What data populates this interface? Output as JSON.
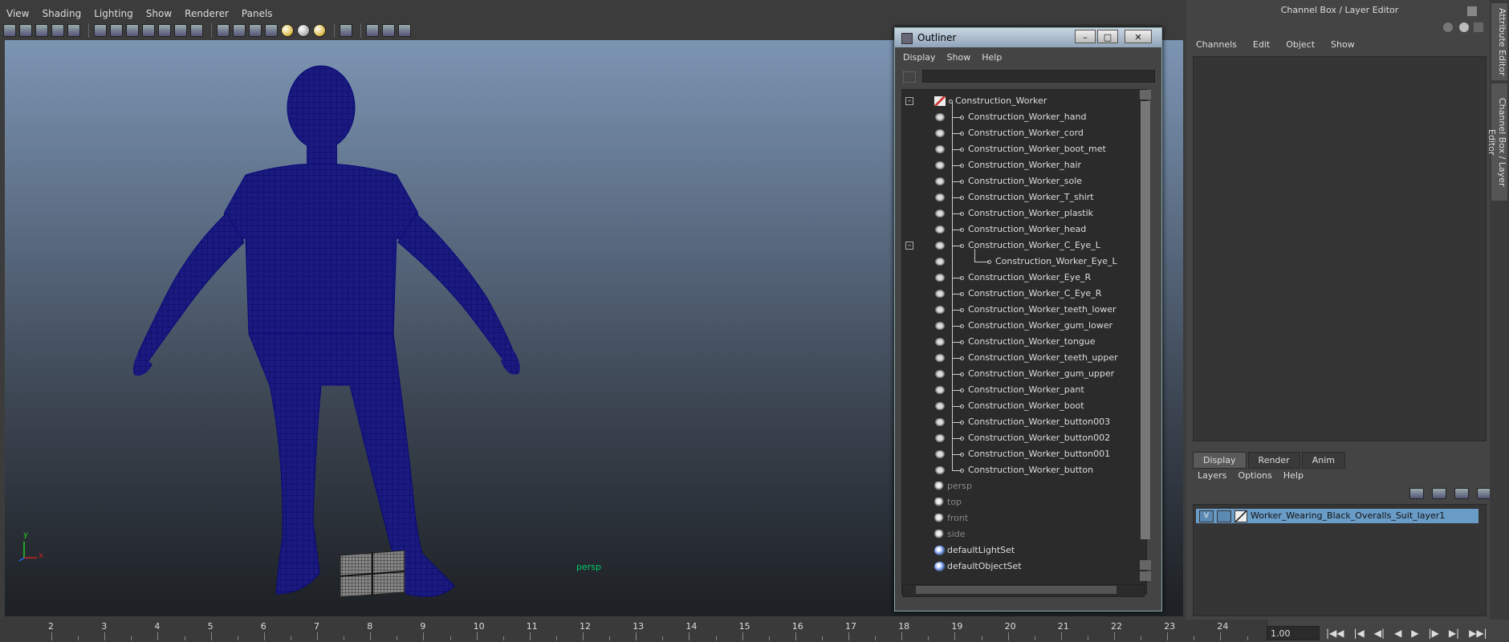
{
  "viewport": {
    "menu": [
      "View",
      "Shading",
      "Lighting",
      "Show",
      "Renderer",
      "Panels"
    ],
    "camera_label": "persp",
    "axis_labels": {
      "y": "y",
      "x": "x"
    }
  },
  "outliner": {
    "title": "Outliner",
    "menu": [
      "Display",
      "Show",
      "Help"
    ],
    "filter_value": "",
    "root": "Construction_Worker",
    "children": [
      "Construction_Worker_hand",
      "Construction_Worker_cord",
      "Construction_Worker_boot_met",
      "Construction_Worker_hair",
      "Construction_Worker_sole",
      "Construction_Worker_T_shirt",
      "Construction_Worker_plastik",
      "Construction_Worker_head",
      "Construction_Worker_C_Eye_L",
      "Construction_Worker_Eye_L",
      "Construction_Worker_Eye_R",
      "Construction_Worker_C_Eye_R",
      "Construction_Worker_teeth_lower",
      "Construction_Worker_gum_lower",
      "Construction_Worker_tongue",
      "Construction_Worker_teeth_upper",
      "Construction_Worker_gum_upper",
      "Construction_Worker_pant",
      "Construction_Worker_boot",
      "Construction_Worker_button003",
      "Construction_Worker_button002",
      "Construction_Worker_button001",
      "Construction_Worker_button"
    ],
    "cameras": [
      "persp",
      "top",
      "front",
      "side"
    ],
    "sets": [
      "defaultLightSet",
      "defaultObjectSet"
    ]
  },
  "channel_box": {
    "title": "Channel Box / Layer Editor",
    "menu": [
      "Channels",
      "Edit",
      "Object",
      "Show"
    ]
  },
  "layer_editor": {
    "tabs": [
      "Display",
      "Render",
      "Anim"
    ],
    "menu": [
      "Layers",
      "Options",
      "Help"
    ],
    "layer": {
      "visible": "V",
      "name": "Worker_Wearing_Black_Overalls_Suit_layer1"
    }
  },
  "side_tabs": [
    "Attribute Editor",
    "Channel Box / Layer Editor"
  ],
  "timeline": {
    "frames": [
      "2",
      "3",
      "4",
      "5",
      "6",
      "7",
      "8",
      "9",
      "10",
      "11",
      "12",
      "13",
      "14",
      "15",
      "16",
      "17",
      "18",
      "19",
      "20",
      "21",
      "22",
      "23",
      "24"
    ],
    "current_time": "1.00"
  },
  "colors": {
    "wireframe": "#0a0a78",
    "selection": "#6a9cc8",
    "camera_label": "#00cc66"
  }
}
